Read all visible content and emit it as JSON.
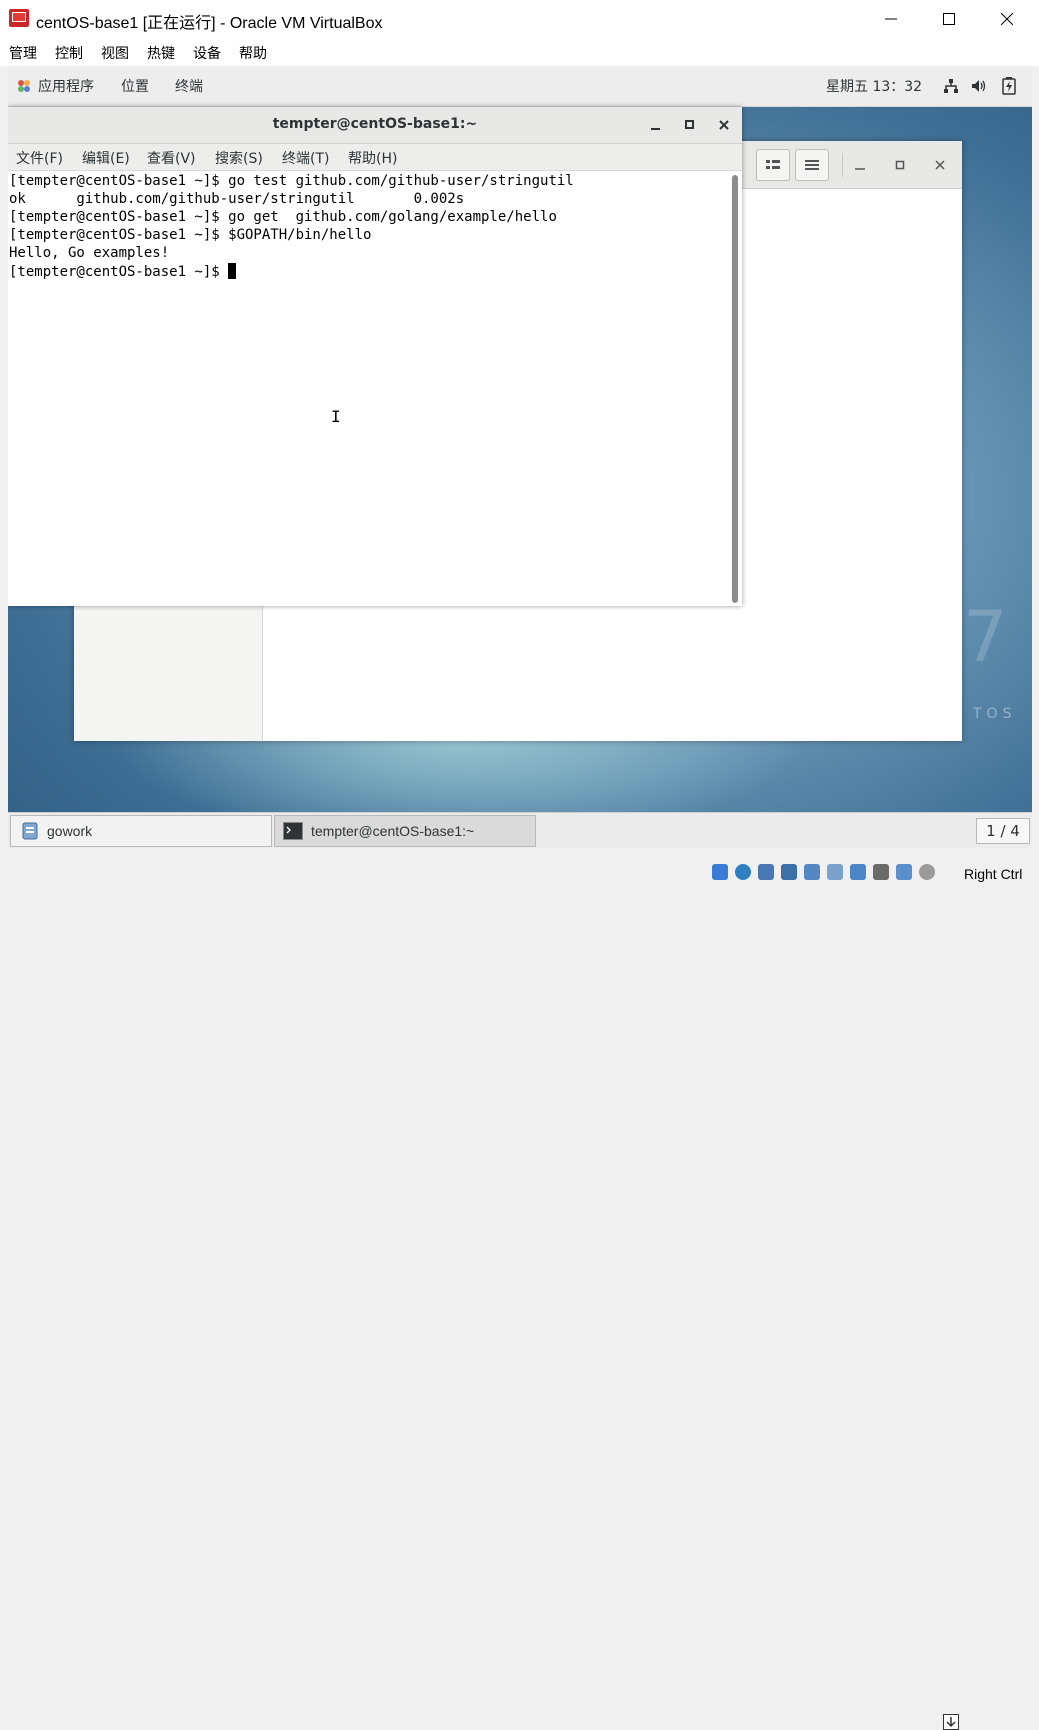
{
  "window": {
    "title": "centOS-base1 [正在运行] - Oracle VM VirtualBox",
    "menu": [
      "管理",
      "控制",
      "视图",
      "热键",
      "设备",
      "帮助"
    ]
  },
  "topbar": {
    "apps": "应用程序",
    "places": "位置",
    "terminal": "终端",
    "clock": "星期五 13：32"
  },
  "terminal": {
    "title": "tempter@centOS-base1:~",
    "menu": [
      "文件(F)",
      "编辑(E)",
      "查看(V)",
      "搜索(S)",
      "终端(T)",
      "帮助(H)"
    ],
    "lines": [
      "[tempter@centOS-base1 ~]$ go test github.com/github-user/stringutil",
      "ok      github.com/github-user/stringutil       0.002s",
      "[tempter@centOS-base1 ~]$ go get  github.com/golang/example/hello",
      "[tempter@centOS-base1 ~]$ $GOPATH/bin/hello",
      "Hello, Go examples!",
      "[tempter@centOS-base1 ~]$ "
    ]
  },
  "desktop": {
    "watermark_number": "7",
    "watermark_text": "TOS"
  },
  "taskbar": {
    "items": [
      "gowork",
      "tempter@centOS-base1:~"
    ],
    "workspace": "1 / 4"
  },
  "statusbar": {
    "host_key": "Right Ctrl"
  }
}
